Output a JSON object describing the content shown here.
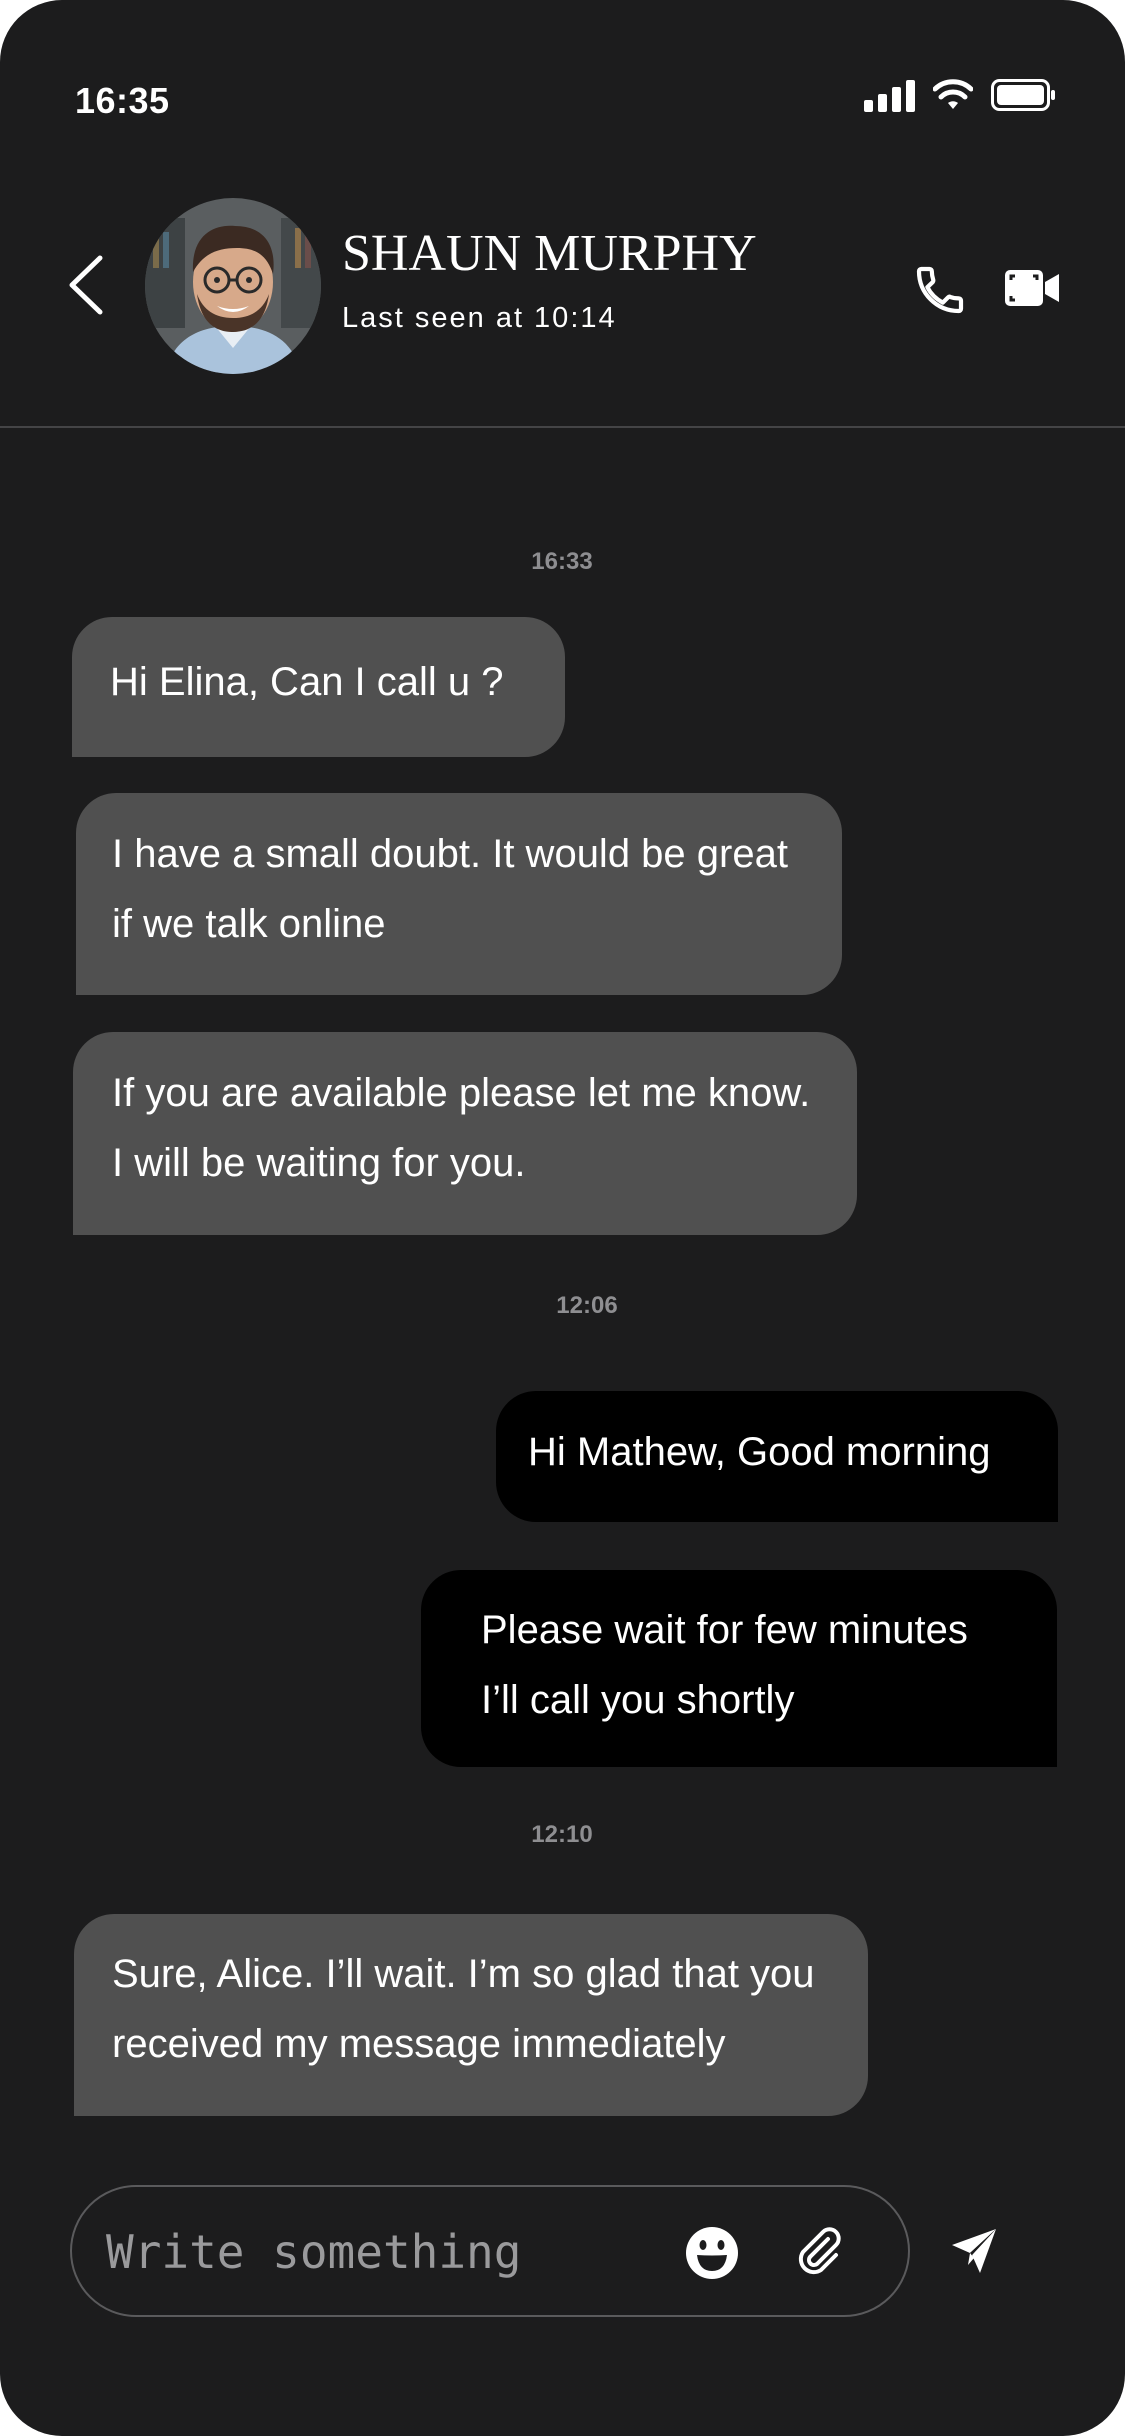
{
  "status_bar": {
    "time": "16:35"
  },
  "header": {
    "contact_name": "SHAUN MURPHY",
    "last_seen": "Last seen at 10:14"
  },
  "messages": [
    {
      "type": "timestamp",
      "text": "16:33"
    },
    {
      "type": "incoming",
      "text": "Hi Elina, Can I call u ?"
    },
    {
      "type": "incoming",
      "text": "I have a small doubt. It would be great\nif we talk online"
    },
    {
      "type": "incoming",
      "text": "If you are available please let me know.\nI will be waiting for you."
    },
    {
      "type": "timestamp",
      "text": "12:06"
    },
    {
      "type": "outgoing",
      "text": "Hi Mathew, Good morning"
    },
    {
      "type": "outgoing",
      "text": "Please wait for few minutes\nI’ll call you shortly"
    },
    {
      "type": "timestamp",
      "text": "12:10"
    },
    {
      "type": "incoming",
      "text": "Sure, Alice. I’ll wait. I’m so glad that you\nreceived my message immediately"
    }
  ],
  "composer": {
    "placeholder": "Write something"
  },
  "colors": {
    "background": "#1c1c1d",
    "incoming_bubble": "#505050",
    "outgoing_bubble": "#000000",
    "timestamp": "#8e8e91"
  },
  "icons": {
    "back": "chevron-left-icon",
    "call": "phone-icon",
    "video": "video-camera-icon",
    "emoji": "emoji-icon",
    "attach": "paperclip-icon",
    "send": "send-icon"
  }
}
